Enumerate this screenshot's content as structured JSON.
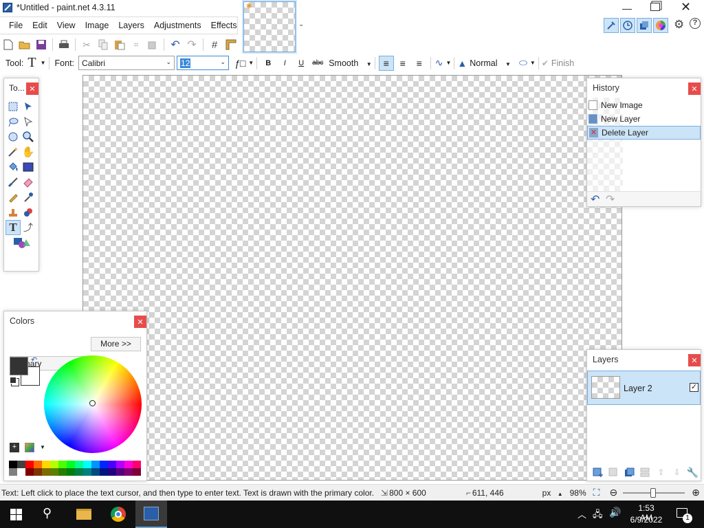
{
  "window": {
    "title": "*Untitled - paint.net 4.3.11"
  },
  "menu": [
    "File",
    "Edit",
    "View",
    "Image",
    "Layers",
    "Adjustments",
    "Effects"
  ],
  "toolbar": {
    "tool_label": "Tool:",
    "font_label": "Font:",
    "font_value": "Calibri",
    "size_value": "12",
    "antialias_value": "Smooth",
    "blend_value": "Normal",
    "finish_label": "Finish"
  },
  "tools_panel": {
    "title": "To..."
  },
  "history_panel": {
    "title": "History",
    "items": [
      {
        "label": "New Image",
        "selected": false
      },
      {
        "label": "New Layer",
        "selected": false
      },
      {
        "label": "Delete Layer",
        "selected": true
      }
    ]
  },
  "colors_panel": {
    "title": "Colors",
    "mode_value": "Primary",
    "more_label": "More >>",
    "primary_color": "#333333",
    "secondary_color": "#ffffff"
  },
  "layers_panel": {
    "title": "Layers",
    "layers": [
      {
        "name": "Layer 2",
        "visible": true,
        "selected": true
      }
    ]
  },
  "status": {
    "hint": "Text: Left click to place the text cursor, and then type to enter text. Text is drawn with the primary color.",
    "image_size": "800 × 600",
    "cursor_pos": "611, 446",
    "units": "px",
    "zoom": "98%"
  },
  "taskbar": {
    "time": "1:53 AM",
    "date": "6/9/2022",
    "notifications": "1"
  },
  "palette": [
    "#000000",
    "#404040",
    "#ff0000",
    "#ff6a00",
    "#ffd800",
    "#b6ff00",
    "#4cff00",
    "#00ff21",
    "#00ff90",
    "#00ffff",
    "#0094ff",
    "#0026ff",
    "#4800ff",
    "#b200ff",
    "#ff00dc",
    "#ff006e"
  ]
}
